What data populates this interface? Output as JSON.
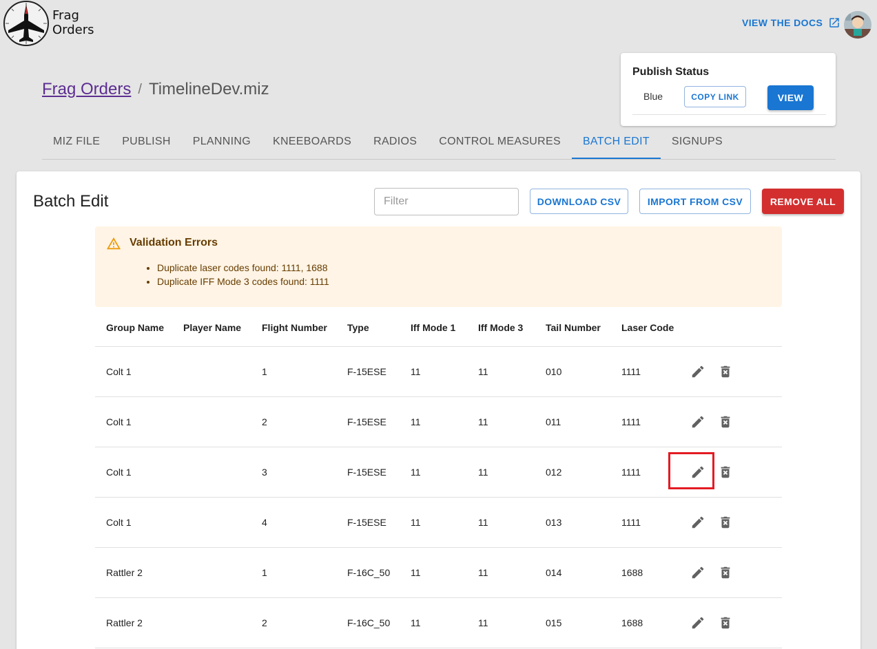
{
  "header": {
    "logo_line1": "Frag",
    "logo_line2": "Orders",
    "docs_link": "VIEW THE DOCS"
  },
  "breadcrumb": {
    "root": "Frag Orders",
    "separator": "/",
    "current": "TimelineDev.miz"
  },
  "publish": {
    "title": "Publish Status",
    "team": "Blue",
    "copy_label": "COPY LINK",
    "view_label": "VIEW"
  },
  "tabs": [
    "MIZ FILE",
    "PUBLISH",
    "PLANNING",
    "KNEEBOARDS",
    "RADIOS",
    "CONTROL MEASURES",
    "BATCH EDIT",
    "SIGNUPS"
  ],
  "active_tab": "BATCH EDIT",
  "batch": {
    "title": "Batch Edit",
    "filter_placeholder": "Filter",
    "download_label": "DOWNLOAD CSV",
    "import_label": "IMPORT FROM CSV",
    "remove_label": "REMOVE ALL"
  },
  "validation": {
    "title": "Validation Errors",
    "errors": [
      "Duplicate laser codes found: 1111, 1688",
      "Duplicate IFF Mode 3 codes found: 1111"
    ]
  },
  "table": {
    "columns": [
      "Group Name",
      "Player Name",
      "Flight Number",
      "Type",
      "Iff Mode 1",
      "Iff Mode 3",
      "Tail Number",
      "Laser Code"
    ],
    "rows": [
      [
        "Colt 1",
        "",
        "1",
        "F-15ESE",
        "11",
        "11",
        "010",
        "1111"
      ],
      [
        "Colt 1",
        "",
        "2",
        "F-15ESE",
        "11",
        "11",
        "011",
        "1111"
      ],
      [
        "Colt 1",
        "",
        "3",
        "F-15ESE",
        "11",
        "11",
        "012",
        "1111"
      ],
      [
        "Colt 1",
        "",
        "4",
        "F-15ESE",
        "11",
        "11",
        "013",
        "1111"
      ],
      [
        "Rattler 2",
        "",
        "1",
        "F-16C_50",
        "11",
        "11",
        "014",
        "1688"
      ],
      [
        "Rattler 2",
        "",
        "2",
        "F-16C_50",
        "11",
        "11",
        "015",
        "1688"
      ]
    ]
  },
  "colors": {
    "primary": "#1976d2",
    "danger": "#d32f2f",
    "warning_bg": "#fff4e5",
    "highlight": "#e31b23"
  }
}
